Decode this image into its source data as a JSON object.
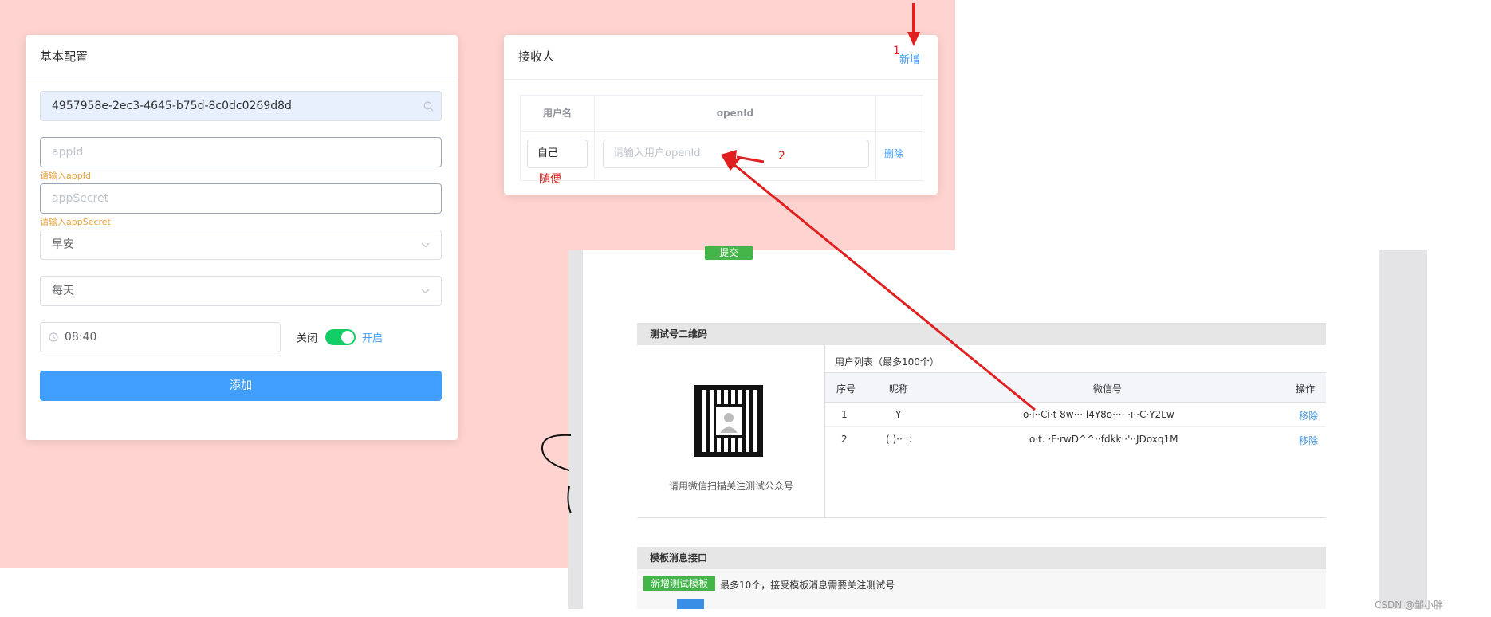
{
  "config_card": {
    "title": "基本配置",
    "template_id_value": "4957958e-2ec3-4645-b75d-8c0dc0269d8d",
    "appid_placeholder": "appId",
    "appid_error": "请输入appId",
    "appsecret_placeholder": "appSecret",
    "appsecret_error": "请输入appSecret",
    "type_select_value": "早安",
    "frequency_select_value": "每天",
    "time_value": "08:40",
    "switch_off_label": "关闭",
    "switch_on_label": "开启",
    "add_button": "添加"
  },
  "receiver_card": {
    "title": "接收人",
    "add_link": "新增",
    "columns": [
      "用户名",
      "openId",
      ""
    ],
    "row": {
      "username_value": "自己",
      "openid_placeholder": "请输入用户openId",
      "delete_link": "删除"
    }
  },
  "annotations": {
    "step1": "1",
    "step2": "2",
    "free_note": "随便"
  },
  "embedded_screenshot": {
    "submit_button": "提交",
    "qr_section_title": "测试号二维码",
    "qr_caption": "请用微信扫描关注测试公众号",
    "user_list_title": "用户列表（最多100个）",
    "columns": [
      "序号",
      "昵称",
      "微信号",
      "操作"
    ],
    "rows": [
      {
        "index": "1",
        "nickname": "Y",
        "wechat_id": "o·i··Ci·t 8w··· l4Y8o···· ·ı··C·Y2Lw",
        "action": "移除"
      },
      {
        "index": "2",
        "nickname": "(.)·· ·:",
        "wechat_id": "o·t. ·F·rwD^^··fdkk··'··JDoxq1M",
        "action": "移除"
      }
    ],
    "template_section_title": "模板消息接口",
    "add_template_button": "新增测试模板",
    "template_note": "最多10个，接受模板消息需要关注测试号"
  },
  "watermark": "CSDN @邹小胖",
  "colors": {
    "page_background": "#ffd4d0",
    "primary": "#409eff",
    "switch_on": "#13ce66",
    "annotation_red": "#e02020",
    "wechat_green": "#44b549"
  }
}
